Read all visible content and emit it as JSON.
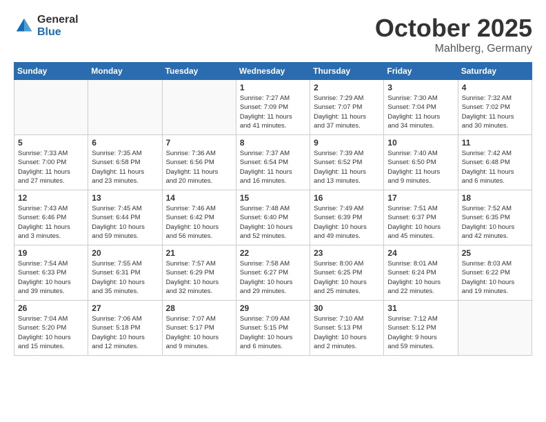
{
  "header": {
    "logo_general": "General",
    "logo_blue": "Blue",
    "month": "October 2025",
    "location": "Mahlberg, Germany"
  },
  "days_of_week": [
    "Sunday",
    "Monday",
    "Tuesday",
    "Wednesday",
    "Thursday",
    "Friday",
    "Saturday"
  ],
  "weeks": [
    [
      {
        "day": "",
        "info": ""
      },
      {
        "day": "",
        "info": ""
      },
      {
        "day": "",
        "info": ""
      },
      {
        "day": "1",
        "info": "Sunrise: 7:27 AM\nSunset: 7:09 PM\nDaylight: 11 hours\nand 41 minutes."
      },
      {
        "day": "2",
        "info": "Sunrise: 7:29 AM\nSunset: 7:07 PM\nDaylight: 11 hours\nand 37 minutes."
      },
      {
        "day": "3",
        "info": "Sunrise: 7:30 AM\nSunset: 7:04 PM\nDaylight: 11 hours\nand 34 minutes."
      },
      {
        "day": "4",
        "info": "Sunrise: 7:32 AM\nSunset: 7:02 PM\nDaylight: 11 hours\nand 30 minutes."
      }
    ],
    [
      {
        "day": "5",
        "info": "Sunrise: 7:33 AM\nSunset: 7:00 PM\nDaylight: 11 hours\nand 27 minutes."
      },
      {
        "day": "6",
        "info": "Sunrise: 7:35 AM\nSunset: 6:58 PM\nDaylight: 11 hours\nand 23 minutes."
      },
      {
        "day": "7",
        "info": "Sunrise: 7:36 AM\nSunset: 6:56 PM\nDaylight: 11 hours\nand 20 minutes."
      },
      {
        "day": "8",
        "info": "Sunrise: 7:37 AM\nSunset: 6:54 PM\nDaylight: 11 hours\nand 16 minutes."
      },
      {
        "day": "9",
        "info": "Sunrise: 7:39 AM\nSunset: 6:52 PM\nDaylight: 11 hours\nand 13 minutes."
      },
      {
        "day": "10",
        "info": "Sunrise: 7:40 AM\nSunset: 6:50 PM\nDaylight: 11 hours\nand 9 minutes."
      },
      {
        "day": "11",
        "info": "Sunrise: 7:42 AM\nSunset: 6:48 PM\nDaylight: 11 hours\nand 6 minutes."
      }
    ],
    [
      {
        "day": "12",
        "info": "Sunrise: 7:43 AM\nSunset: 6:46 PM\nDaylight: 11 hours\nand 3 minutes."
      },
      {
        "day": "13",
        "info": "Sunrise: 7:45 AM\nSunset: 6:44 PM\nDaylight: 10 hours\nand 59 minutes."
      },
      {
        "day": "14",
        "info": "Sunrise: 7:46 AM\nSunset: 6:42 PM\nDaylight: 10 hours\nand 56 minutes."
      },
      {
        "day": "15",
        "info": "Sunrise: 7:48 AM\nSunset: 6:40 PM\nDaylight: 10 hours\nand 52 minutes."
      },
      {
        "day": "16",
        "info": "Sunrise: 7:49 AM\nSunset: 6:39 PM\nDaylight: 10 hours\nand 49 minutes."
      },
      {
        "day": "17",
        "info": "Sunrise: 7:51 AM\nSunset: 6:37 PM\nDaylight: 10 hours\nand 45 minutes."
      },
      {
        "day": "18",
        "info": "Sunrise: 7:52 AM\nSunset: 6:35 PM\nDaylight: 10 hours\nand 42 minutes."
      }
    ],
    [
      {
        "day": "19",
        "info": "Sunrise: 7:54 AM\nSunset: 6:33 PM\nDaylight: 10 hours\nand 39 minutes."
      },
      {
        "day": "20",
        "info": "Sunrise: 7:55 AM\nSunset: 6:31 PM\nDaylight: 10 hours\nand 35 minutes."
      },
      {
        "day": "21",
        "info": "Sunrise: 7:57 AM\nSunset: 6:29 PM\nDaylight: 10 hours\nand 32 minutes."
      },
      {
        "day": "22",
        "info": "Sunrise: 7:58 AM\nSunset: 6:27 PM\nDaylight: 10 hours\nand 29 minutes."
      },
      {
        "day": "23",
        "info": "Sunrise: 8:00 AM\nSunset: 6:25 PM\nDaylight: 10 hours\nand 25 minutes."
      },
      {
        "day": "24",
        "info": "Sunrise: 8:01 AM\nSunset: 6:24 PM\nDaylight: 10 hours\nand 22 minutes."
      },
      {
        "day": "25",
        "info": "Sunrise: 8:03 AM\nSunset: 6:22 PM\nDaylight: 10 hours\nand 19 minutes."
      }
    ],
    [
      {
        "day": "26",
        "info": "Sunrise: 7:04 AM\nSunset: 5:20 PM\nDaylight: 10 hours\nand 15 minutes."
      },
      {
        "day": "27",
        "info": "Sunrise: 7:06 AM\nSunset: 5:18 PM\nDaylight: 10 hours\nand 12 minutes."
      },
      {
        "day": "28",
        "info": "Sunrise: 7:07 AM\nSunset: 5:17 PM\nDaylight: 10 hours\nand 9 minutes."
      },
      {
        "day": "29",
        "info": "Sunrise: 7:09 AM\nSunset: 5:15 PM\nDaylight: 10 hours\nand 6 minutes."
      },
      {
        "day": "30",
        "info": "Sunrise: 7:10 AM\nSunset: 5:13 PM\nDaylight: 10 hours\nand 2 minutes."
      },
      {
        "day": "31",
        "info": "Sunrise: 7:12 AM\nSunset: 5:12 PM\nDaylight: 9 hours\nand 59 minutes."
      },
      {
        "day": "",
        "info": ""
      }
    ]
  ]
}
